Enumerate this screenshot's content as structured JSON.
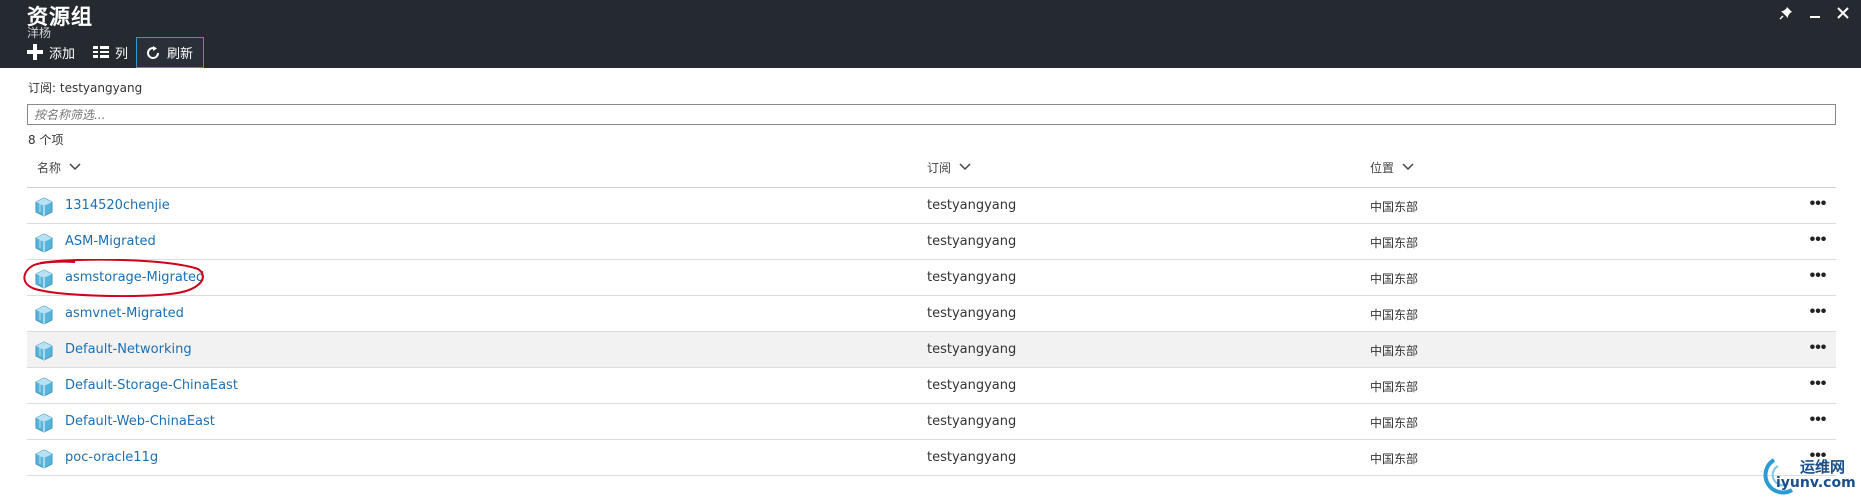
{
  "blade": {
    "title": "资源组",
    "subtitle": "洋杨",
    "pin_icon": "pin-icon",
    "minimize_icon": "minimize-icon",
    "close_icon": "close-icon"
  },
  "toolbar": {
    "add_label": "添加",
    "columns_label": "列",
    "refresh_label": "刷新"
  },
  "subscription_line": "订阅: testyangyang",
  "filter": {
    "placeholder": "按名称筛选...",
    "value": ""
  },
  "count_line": "8 个项",
  "columns": {
    "name": "名称",
    "subscription": "订阅",
    "location": "位置"
  },
  "rows": [
    {
      "name": "1314520chenjie",
      "subscription": "testyangyang",
      "location": "中国东部",
      "more": "•••"
    },
    {
      "name": "ASM-Migrated",
      "subscription": "testyangyang",
      "location": "中国东部",
      "more": "•••"
    },
    {
      "name": "asmstorage-Migrated",
      "subscription": "testyangyang",
      "location": "中国东部",
      "more": "•••"
    },
    {
      "name": "asmvnet-Migrated",
      "subscription": "testyangyang",
      "location": "中国东部",
      "more": "•••"
    },
    {
      "name": "Default-Networking",
      "subscription": "testyangyang",
      "location": "中国东部",
      "more": "•••"
    },
    {
      "name": "Default-Storage-ChinaEast",
      "subscription": "testyangyang",
      "location": "中国东部",
      "more": "•••"
    },
    {
      "name": "Default-Web-ChinaEast",
      "subscription": "testyangyang",
      "location": "中国东部",
      "more": "•••"
    },
    {
      "name": "poc-oracle11g",
      "subscription": "testyangyang",
      "location": "中国东部",
      "more": "•••"
    }
  ],
  "watermark": {
    "line1": "运维网",
    "line2": "iyunv.com"
  },
  "colors": {
    "header_bg": "#252a31",
    "link": "#1a6fb5",
    "accent": "#2b9bd6",
    "highlight": "#d0021b"
  }
}
